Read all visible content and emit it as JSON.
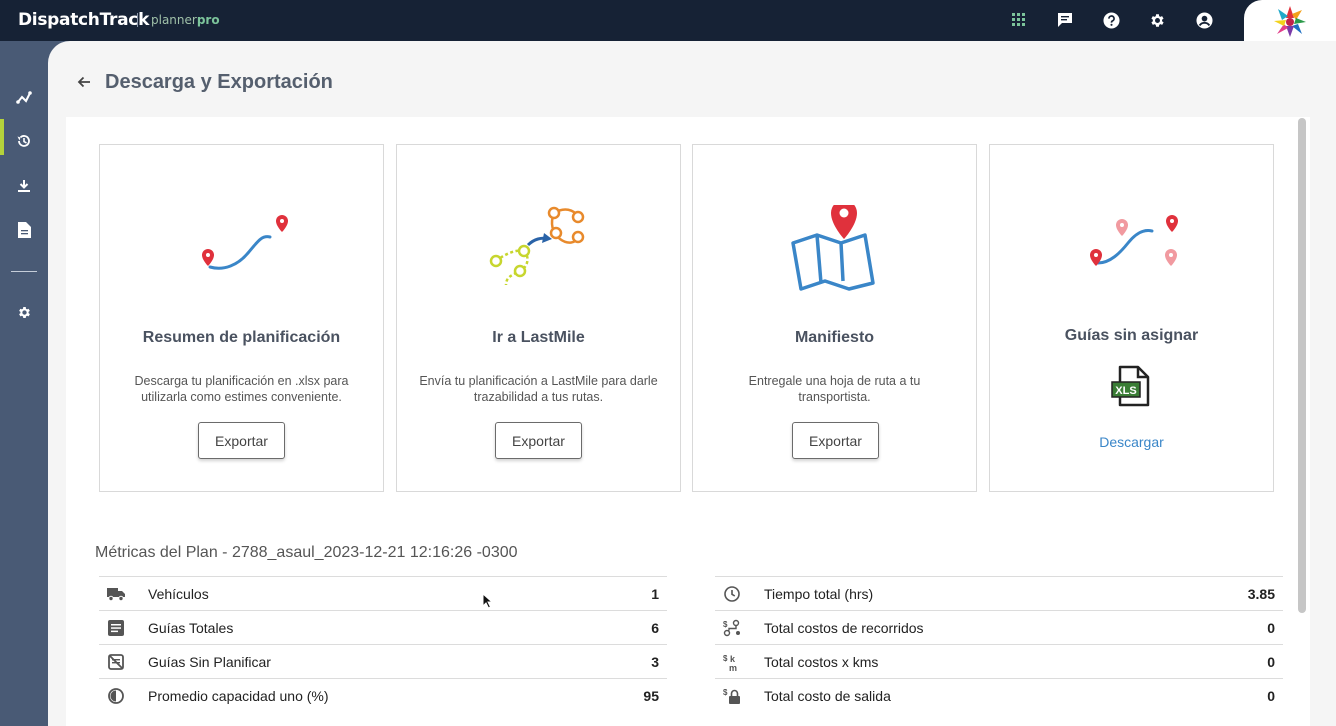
{
  "topbar": {
    "brand": "DispatchTrack",
    "product_prefix": "planner",
    "product_suffix": "pro",
    "icons": [
      "apps-grid-icon",
      "chat-icon",
      "help-icon",
      "settings-icon",
      "account-icon"
    ]
  },
  "sidebar": {
    "items": [
      {
        "icon": "route-icon",
        "active": true
      },
      {
        "icon": "history-icon",
        "active": false
      },
      {
        "icon": "download-icon",
        "active": false
      },
      {
        "icon": "document-icon",
        "active": false
      },
      {
        "icon": "settings-icon",
        "active": false
      }
    ]
  },
  "page": {
    "title": "Descarga y Exportación"
  },
  "cards": [
    {
      "title": "Resumen de planificación",
      "description": "Descarga tu planificación en .xlsx para utilizarla como estimes conveniente.",
      "button": "Exportar",
      "icon": "route-map-icon"
    },
    {
      "title": "Ir a LastMile",
      "description": "Envía tu planificación a LastMile para darle trazabilidad a tus rutas.",
      "button": "Exportar",
      "icon": "lastmile-transfer-icon"
    },
    {
      "title": "Manifiesto",
      "description": "Entregale una hoja de ruta a tu transportista.",
      "button": "Exportar",
      "icon": "map-pin-icon"
    },
    {
      "title": "Guías sin asignar",
      "link": "Descargar",
      "icon": "xls-file-icon",
      "file_label": "XLS"
    }
  ],
  "metrics": {
    "title": "Métricas del Plan - 2788_asaul_2023-12-21 12:16:26 -0300",
    "left": [
      {
        "label": "Vehículos",
        "value": "1",
        "icon": "truck-icon"
      },
      {
        "label": "Guías Totales",
        "value": "6",
        "icon": "list-icon"
      },
      {
        "label": "Guías Sin Planificar",
        "value": "3",
        "icon": "unplanned-icon"
      },
      {
        "label": "Promedio capacidad uno (%)",
        "value": "95",
        "icon": "capacity-icon"
      }
    ],
    "right": [
      {
        "label": "Tiempo total (hrs)",
        "value": "3.85",
        "icon": "clock-icon"
      },
      {
        "label": "Total costos de recorridos",
        "value": "0",
        "icon": "route-cost-icon"
      },
      {
        "label": "Total costos x kms",
        "value": "0",
        "icon": "km-cost-icon"
      },
      {
        "label": "Total costo de salida",
        "value": "0",
        "icon": "lock-cost-icon"
      }
    ]
  },
  "colors": {
    "topbar": "#162235",
    "sidebar": "#495a75",
    "accent": "#b4d23b",
    "link": "#3a86c8",
    "pin": "#e0313c",
    "route": "#3a86c8"
  }
}
